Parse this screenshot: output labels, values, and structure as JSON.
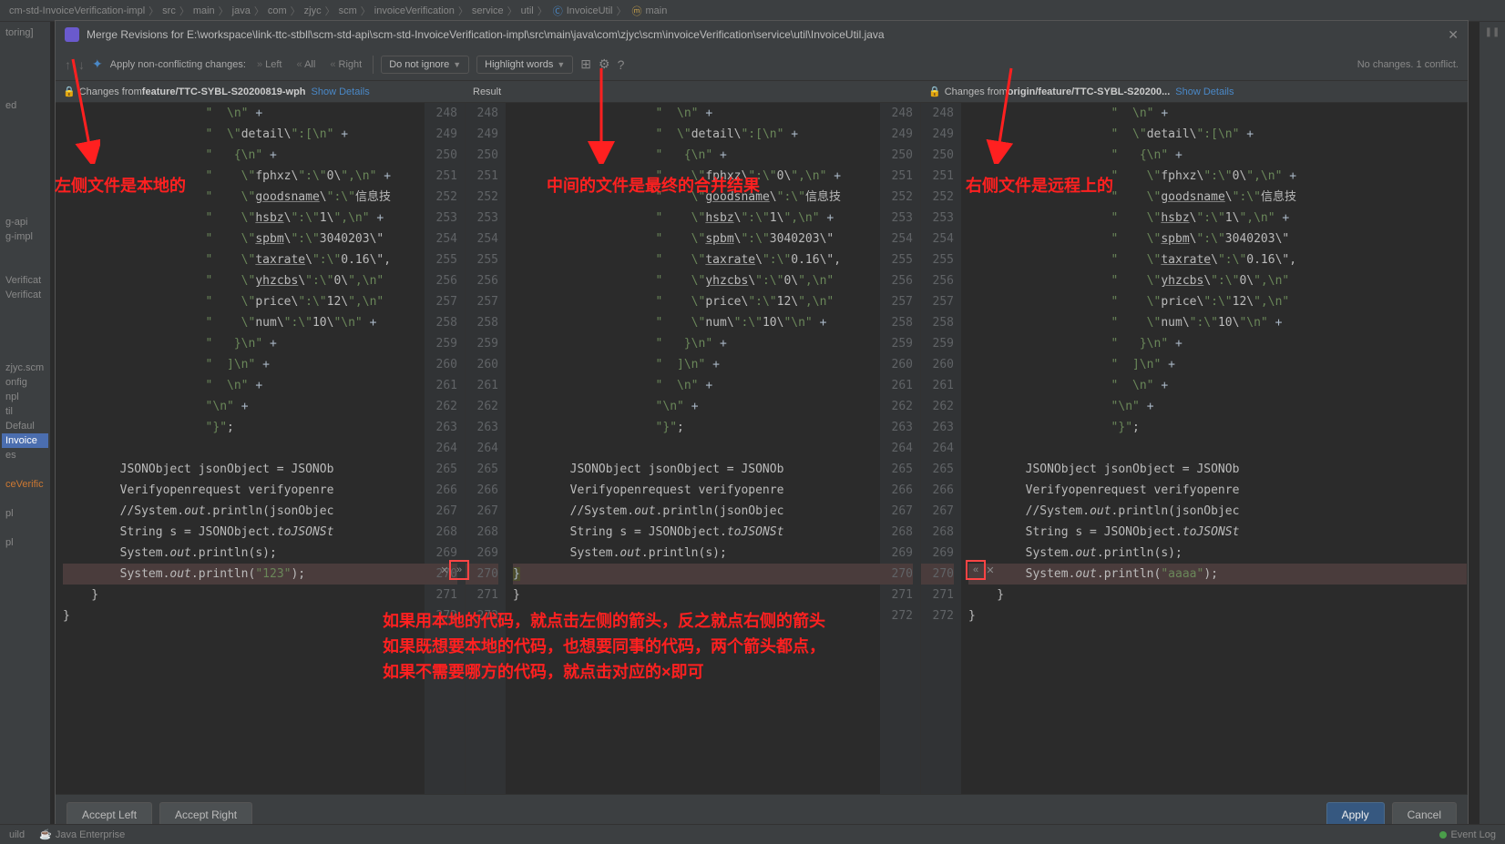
{
  "breadcrumb": {
    "items": [
      "cm-std-InvoiceVerification-impl",
      "src",
      "main",
      "java",
      "com",
      "zjyc",
      "scm",
      "invoiceVerification",
      "service",
      "util"
    ],
    "file": "InvoiceUtil",
    "method": "main"
  },
  "dialog": {
    "title": "Merge Revisions for E:\\workspace\\link-ttc-stbll\\scm-std-api\\scm-std-InvoiceVerification-impl\\src\\main\\java\\com\\zjyc\\scm\\invoiceVerification\\service\\util\\InvoiceUtil.java"
  },
  "toolbar": {
    "apply_label": "Apply non-conflicting changes:",
    "left": "Left",
    "all": "All",
    "right": "Right",
    "ignore_dd": "Do not ignore",
    "highlight_dd": "Highlight words",
    "status": "No changes. 1 conflict."
  },
  "panes": {
    "left_prefix": "Changes from ",
    "left_branch": "feature/TTC-SYBL-S20200819-wph",
    "mid_title": "Result",
    "right_prefix": "Changes from ",
    "right_branch": "origin/feature/TTC-SYBL-S20200...",
    "show_details": "Show Details"
  },
  "line_numbers": {
    "start": 248,
    "end": 272
  },
  "code_lines": {
    "l248": "\"  \\n\" +",
    "l249": "\"  \\\"detail\\\":[\\n\" +",
    "l250": "\"   {\\n\" +",
    "l251": "\"    \\\"fphxz\\\":\\\"0\\\",\\n\" +",
    "l252": "\"    \\\"goodsname\\\":\\\"信息技",
    "l253": "\"    \\\"hsbz\\\":\\\"1\\\",\\n\" +",
    "l254": "\"    \\\"spbm\\\":\\\"3040203\\\"",
    "l255": "\"    \\\"taxrate\\\":\\\"0.16\\\",",
    "l256": "\"    \\\"yhzcbs\\\":\\\"0\\\",\\n\"",
    "l257": "\"    \\\"price\\\":\\\"12\\\",\\n\"",
    "l258": "\"    \\\"num\\\":\\\"10\\\"\\n\" +",
    "l259": "\"   }\\n\" +",
    "l260": "\"  ]\\n\" +",
    "l261": "\"  \\n\" +",
    "l262": "\"\\n\" +",
    "l263": "\"}\";",
    "l264": "",
    "l265": "JSONObject jsonObject = JSONOb",
    "l266": "Verifyopenrequest verifyopenre",
    "l267": "//System.out.println(jsonObjec",
    "l268": "String s = JSONObject.toJSONSt",
    "l269": "System.out.println(s);",
    "l270_left": "System.out.println(\"123\");",
    "l270_mid": "}",
    "l270_right": "System.out.println(\"aaaa\");",
    "l271": "}",
    "l272": ""
  },
  "buttons": {
    "accept_left": "Accept Left",
    "accept_right": "Accept Right",
    "apply": "Apply",
    "cancel": "Cancel"
  },
  "statusbar": {
    "build": "uild",
    "java_ee": "Java Enterprise",
    "event_log": "Event Log"
  },
  "sidebar": {
    "items": [
      "toring]",
      "",
      "",
      "",
      "",
      "ed",
      "",
      "",
      "",
      "",
      "",
      "",
      "",
      "g-api",
      "g-impl",
      "",
      "",
      "Verificat",
      "Verificat",
      "",
      "",
      "",
      "",
      "zjyc.scm",
      "onfig",
      "npl",
      "til",
      "Defaul",
      "Invoice",
      "es",
      "",
      "ceVerific",
      "",
      "pl",
      "",
      "pl"
    ]
  },
  "annotations": {
    "left": "左侧文件是本地的",
    "mid": "中间的文件是最终的合并结果",
    "right": "右侧文件是远程上的",
    "bottom1": "如果用本地的代码，就点击左侧的箭头，反之就点右侧的箭头",
    "bottom2": "如果既想要本地的代码，也想要同事的代码，两个箭头都点，",
    "bottom3": "如果不需要哪方的代码，就点击对应的×即可"
  }
}
